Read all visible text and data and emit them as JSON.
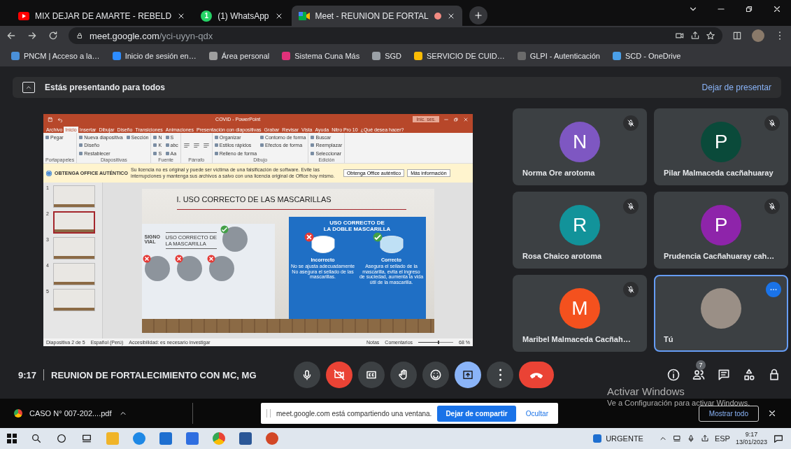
{
  "browser": {
    "tabs": [
      {
        "title": "MIX DEJAR DE AMARTE - REBELD",
        "kind": "video",
        "recording": false,
        "selected": false
      },
      {
        "title": "(1) WhatsApp",
        "kind": "chat",
        "badge": "1",
        "recording": false,
        "selected": false
      },
      {
        "title": "Meet - REUNION DE FORTAL",
        "kind": "meet",
        "recording": true,
        "selected": true
      }
    ],
    "address": {
      "host": "meet.google.com",
      "path": "/yci-uyyn-qdx"
    },
    "bookmarks": [
      {
        "label": "PNCM | Acceso a la…",
        "color": "#4a90d9"
      },
      {
        "label": "Inicio de sesión en…",
        "color": "#2d8cff"
      },
      {
        "label": "Área personal",
        "color": "#9e9e9e"
      },
      {
        "label": "Sistema Cuna Más",
        "color": "#e0317a"
      },
      {
        "label": "SGD",
        "color": "#9aa0a6"
      },
      {
        "label": "SERVICIO DE CUID…",
        "color": "#fbbc04"
      },
      {
        "label": "GLPI - Autenticación",
        "color": "#6b6b6b"
      },
      {
        "label": "SCD - OneDrive",
        "color": "#4a9fe8"
      }
    ]
  },
  "banner": {
    "text": "Estás presentando para todos",
    "action": "Dejar de presentar"
  },
  "presentation": {
    "title": "COVID - PowerPoint",
    "sign_in": "Inic. ses.",
    "ribbon_tabs": [
      {
        "label": "Archivo",
        "selected": false
      },
      {
        "label": "Inicio",
        "selected": true
      },
      {
        "label": "Insertar",
        "selected": false
      },
      {
        "label": "Dibujar",
        "selected": false
      },
      {
        "label": "Diseño",
        "selected": false
      },
      {
        "label": "Transiciones",
        "selected": false
      },
      {
        "label": "Animaciones",
        "selected": false
      },
      {
        "label": "Presentación con diapositivas",
        "selected": false
      },
      {
        "label": "Grabar",
        "selected": false
      },
      {
        "label": "Revisar",
        "selected": false
      },
      {
        "label": "Vista",
        "selected": false
      },
      {
        "label": "Ayuda",
        "selected": false
      },
      {
        "label": "Nitro Pro 10",
        "selected": false
      }
    ],
    "tell_me": "¿Qué desea hacer?",
    "ribbon_groups": [
      {
        "label": "Portapapeles",
        "buttons": [
          "Pegar"
        ]
      },
      {
        "label": "Diapositivas",
        "buttons": [
          "Nueva diapositiva",
          "Diseño",
          "Restablecer",
          "Sección"
        ]
      },
      {
        "label": "Fuente",
        "buttons": [
          "N",
          "K",
          "S",
          "S",
          "abc",
          "Aa"
        ]
      },
      {
        "label": "Párrafo"
      },
      {
        "label": "Dibujo",
        "buttons": [
          "Organizar",
          "Estilos rápidos",
          "Relleno de forma",
          "Contorno de forma",
          "Efectos de forma"
        ]
      },
      {
        "label": "Edición",
        "buttons": [
          "Buscar",
          "Reemplazar",
          "Seleccionar"
        ]
      }
    ],
    "license": {
      "label": "OBTENGA OFFICE AUTÉNTICO",
      "message": "Su licencia no es original y puede ser víctima de una falsificación de software. Evite las interrupciones y mantenga sus archivos a salvo con una licencia original de Office hoy mismo.",
      "buttons": [
        "Obtenga Office auténtico",
        "Más información"
      ]
    },
    "thumbnails": [
      {
        "number": "1",
        "selected": false
      },
      {
        "number": "2",
        "selected": true
      },
      {
        "number": "3",
        "selected": false
      },
      {
        "number": "4",
        "selected": false
      },
      {
        "number": "5",
        "selected": false
      }
    ],
    "slide": {
      "title": "I. USO CORRECTO DE LAS MASCARILLAS",
      "left_panel": {
        "logo": "SIGNO VIAL",
        "heading": [
          "USO CORRECTO DE",
          "LA MASCARILLA"
        ],
        "figures": [
          {
            "correct": true
          },
          {
            "correct": false
          },
          {
            "correct": false
          },
          {
            "correct": false
          }
        ]
      },
      "right_panel": {
        "heading": [
          "USO CORRECTO DE",
          "LA DOBLE MASCARILLA"
        ],
        "options": [
          {
            "label": "Incorrecto",
            "description": "No se ajusta adecuadamente No asegura el sellado de las mascarillas.",
            "correct": false
          },
          {
            "label": "Correcto",
            "description": "Asegura el sellado de la mascarilla, evita el ingreso de suciedad, aumenta la vida útil de la mascarilla.",
            "correct": true
          }
        ]
      }
    },
    "status_left": [
      "Diapositiva 2 de 5",
      "Español (Perú)",
      "Accesibilidad: es necesario investigar"
    ],
    "status_right": [
      "Notas",
      "Comentarios"
    ],
    "zoom": {
      "level": 0.55,
      "reading": "68 %"
    }
  },
  "participants": [
    {
      "name": "Norma Ore arotoma",
      "kind": "avatar",
      "initial": "N",
      "color": "#7e57c2",
      "muted": true,
      "speaking": false
    },
    {
      "name": "Pilar Malmaceda cacñahuaray",
      "kind": "avatar",
      "initial": "P",
      "color": "#0a4a3a",
      "muted": true,
      "speaking": false
    },
    {
      "name": "Rosa Chaico arotoma",
      "kind": "avatar",
      "initial": "R",
      "color": "#12939a",
      "muted": true,
      "speaking": false
    },
    {
      "name": "Prudencia Cacñahuaray cah…",
      "kind": "avatar",
      "initial": "P",
      "color": "#8e24aa",
      "muted": true,
      "speaking": false
    },
    {
      "name": "Maribel Malmaceda Cacñah…",
      "kind": "avatar",
      "initial": "M",
      "color": "#f4511e",
      "muted": true,
      "speaking": false
    },
    {
      "name": "Tú",
      "kind": "photo",
      "muted": false,
      "speaking": true
    }
  ],
  "meeting": {
    "time": "9:17",
    "title": "REUNION DE FORTALECIMIENTO CON MC, MG"
  },
  "controls": [
    {
      "kind": "mic",
      "on": true
    },
    {
      "kind": "camera",
      "on": false
    },
    {
      "kind": "captions",
      "on": false
    },
    {
      "kind": "hand",
      "on": false
    },
    {
      "kind": "emoji",
      "on": false
    },
    {
      "kind": "present",
      "on": true
    },
    {
      "kind": "more",
      "on": false
    },
    {
      "kind": "hangup"
    }
  ],
  "tools": [
    {
      "kind": "info"
    },
    {
      "kind": "people",
      "badge": "7"
    },
    {
      "kind": "chat"
    },
    {
      "kind": "activities"
    },
    {
      "kind": "host"
    }
  ],
  "activation": {
    "title": "Activar Windows",
    "subtitle": "Ve a Configuración para activar Windows."
  },
  "downloads": {
    "file": "CASO N° 007-202....pdf",
    "show_all": "Mostrar todo"
  },
  "share_notice": {
    "message": "meet.google.com está compartiendo una ventana.",
    "stop": "Dejar de compartir",
    "hide": "Ocultar"
  },
  "taskbar": {
    "apps": [
      {
        "kind": "folder"
      },
      {
        "kind": "browser"
      },
      {
        "kind": "mail"
      },
      {
        "kind": "store"
      },
      {
        "kind": "chrome"
      },
      {
        "kind": "word"
      },
      {
        "kind": "powerpoint"
      }
    ],
    "news": "URGENTE",
    "language": "ESP",
    "time": "9:17",
    "date": "13/01/2023"
  }
}
